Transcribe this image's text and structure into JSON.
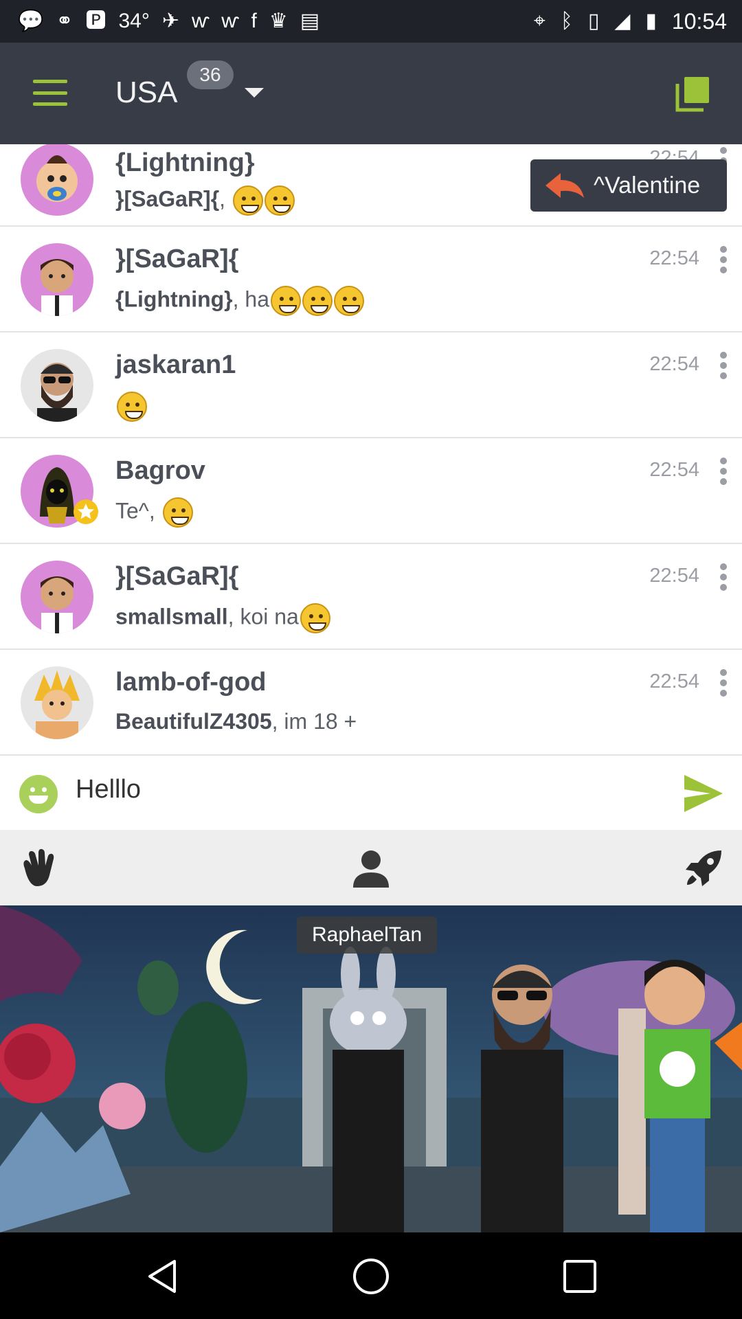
{
  "status_bar": {
    "temperature": "34°",
    "time": "10:54"
  },
  "app_bar": {
    "title": "USA",
    "badge": "36"
  },
  "reply_chip": {
    "label": "^Valentine"
  },
  "messages": [
    {
      "name": "{Lightning}",
      "mention": "}[SaGaR]{",
      "text": ",",
      "time": "22:54"
    },
    {
      "name": "}[SaGaR]{",
      "mention": "{Lightning}",
      "text": ", ha",
      "time": "22:54"
    },
    {
      "name": "jaskaran1",
      "mention": "",
      "text": "",
      "time": "22:54"
    },
    {
      "name": "Bagrov",
      "mention": "",
      "text": "Te^, ",
      "time": "22:54"
    },
    {
      "name": "}[SaGaR]{",
      "mention": "smallsmall",
      "text": ", koi na",
      "time": "22:54"
    },
    {
      "name": "lamb-of-god",
      "mention": "BeautifulZ4305",
      "text": ",  im 18 +",
      "time": "22:54"
    }
  ],
  "composer": {
    "value": "Helllo"
  },
  "scene": {
    "label": "RaphaelTan"
  },
  "colors": {
    "accent": "#9cc23a",
    "app_bar": "#383c47",
    "status_bar": "#1f2228"
  },
  "icons": [
    "menu-icon",
    "copy-icon",
    "reply-icon",
    "more-vert-icon",
    "smiley-icon",
    "send-icon",
    "wave-hand-icon",
    "person-icon",
    "rocket-icon",
    "back-icon",
    "home-icon",
    "recents-icon"
  ]
}
